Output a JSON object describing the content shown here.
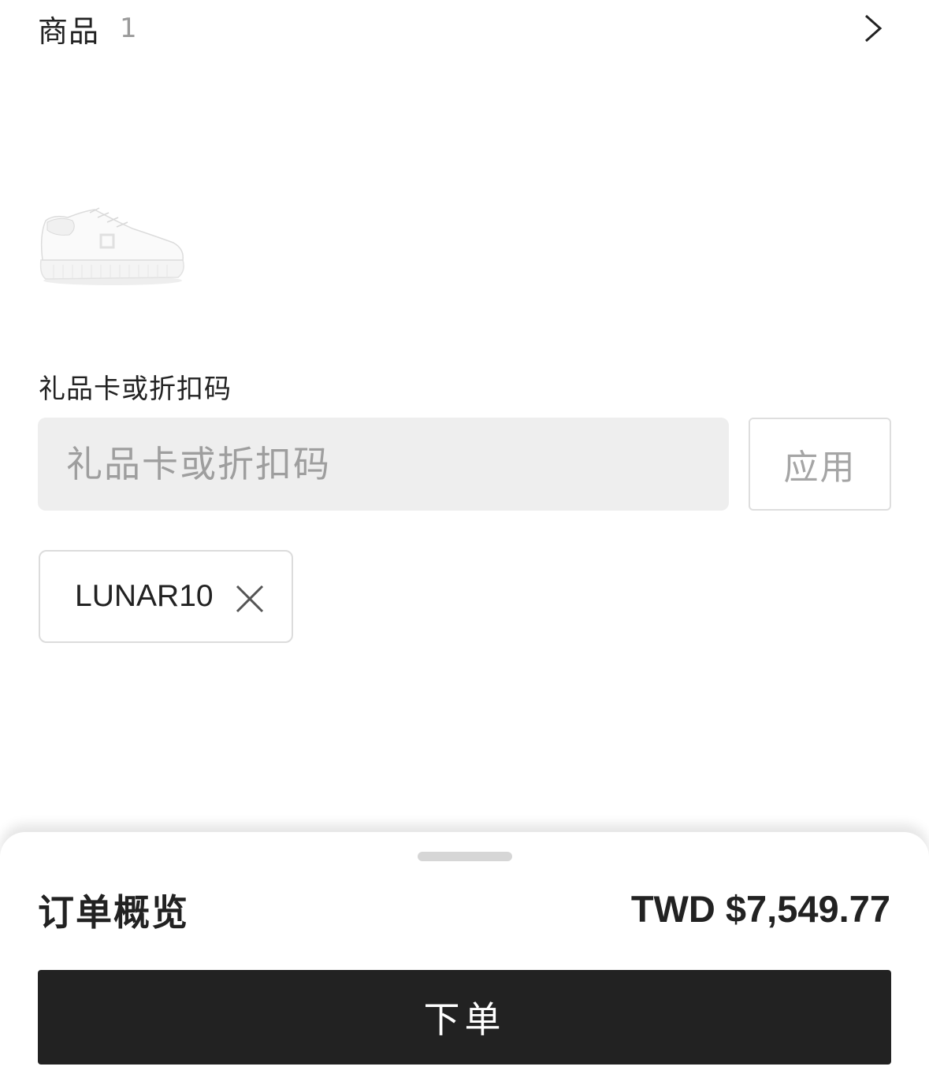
{
  "items_header": {
    "title": "商品",
    "count": "1"
  },
  "product": {
    "image": "white-sneaker"
  },
  "promo": {
    "label": "礼品卡或折扣码",
    "placeholder": "礼品卡或折扣码",
    "value": "",
    "apply_label": "应用",
    "applied_code": "LUNAR10"
  },
  "summary": {
    "title": "订单概览",
    "total": "TWD $7,549.77",
    "place_order_label": "下单"
  },
  "colors": {
    "primary_button": "#222222",
    "input_background": "#eeeeee",
    "muted_text": "#9e9e9e"
  },
  "icons": {
    "header_chevron": "chevron-right-icon",
    "remove_code": "close-icon"
  }
}
